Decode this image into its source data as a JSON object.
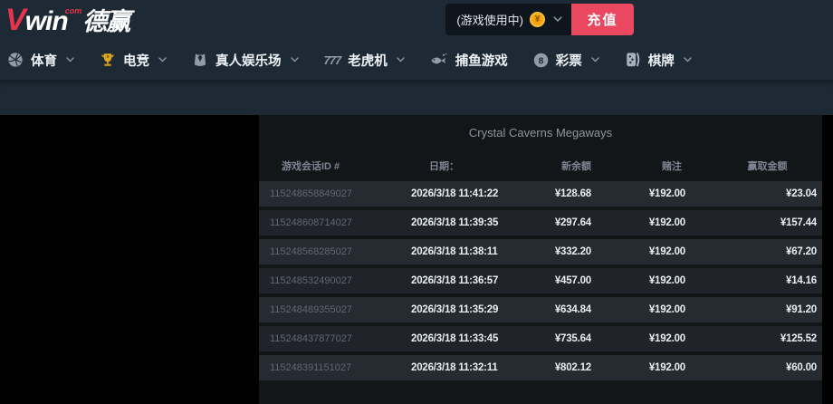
{
  "header": {
    "logo": {
      "v": "V",
      "win": "win",
      "com": "com",
      "cn": "德赢"
    },
    "wallet": {
      "label": "(游戏使用中)",
      "coin_symbol": "¥"
    },
    "deposit_label": "充值"
  },
  "nav": {
    "items": [
      {
        "label": "体育",
        "icon": "basketball-icon",
        "chevron": true
      },
      {
        "label": "电竞",
        "icon": "trophy-icon",
        "chevron": true
      },
      {
        "label": "真人娱乐场",
        "icon": "suit-icon",
        "chevron": true
      },
      {
        "label": "老虎机",
        "icon": "slots-777-icon",
        "chevron": true
      },
      {
        "label": "捕鱼游戏",
        "icon": "fish-icon",
        "chevron": false
      },
      {
        "label": "彩票",
        "icon": "eight-ball-icon",
        "chevron": true
      },
      {
        "label": "棋牌",
        "icon": "tiles-icon",
        "chevron": true
      }
    ]
  },
  "table": {
    "title": "Crystal Caverns Megaways",
    "columns": [
      "游戏会话ID #",
      "日期：",
      "新余额",
      "赌注",
      "赢取金额"
    ],
    "rows": [
      [
        "115248658849027",
        "2026/3/18 11:41:22",
        "¥128.68",
        "¥192.00",
        "¥23.04"
      ],
      [
        "115248608714027",
        "2026/3/18 11:39:35",
        "¥297.64",
        "¥192.00",
        "¥157.44"
      ],
      [
        "115248568285027",
        "2026/3/18 11:38:11",
        "¥332.20",
        "¥192.00",
        "¥67.20"
      ],
      [
        "115248532490027",
        "2026/3/18 11:36:57",
        "¥457.00",
        "¥192.00",
        "¥14.16"
      ],
      [
        "115248489355027",
        "2026/3/18 11:35:29",
        "¥634.84",
        "¥192.00",
        "¥91.20"
      ],
      [
        "115248437877027",
        "2026/3/18 11:33:45",
        "¥735.64",
        "¥192.00",
        "¥125.52"
      ],
      [
        "115248391151027",
        "2026/3/18 11:32:11",
        "¥802.12",
        "¥192.00",
        "¥60.00"
      ]
    ]
  },
  "colors": {
    "accent_red": "#e9485f",
    "logo_red": "#e8344b",
    "coin_gold": "#f5a50f",
    "trophy_gold": "#cc9419",
    "topbar_bg": "#1d2a35",
    "wallet_box_bg": "#0f151d",
    "panel_bg": "#131619",
    "row_odd": "#262a31",
    "row_even": "#20242a",
    "icon_gray": "#929ca7",
    "id_text": "#606872",
    "header_text": "#7c8591",
    "value_text": "#e9eef2"
  }
}
